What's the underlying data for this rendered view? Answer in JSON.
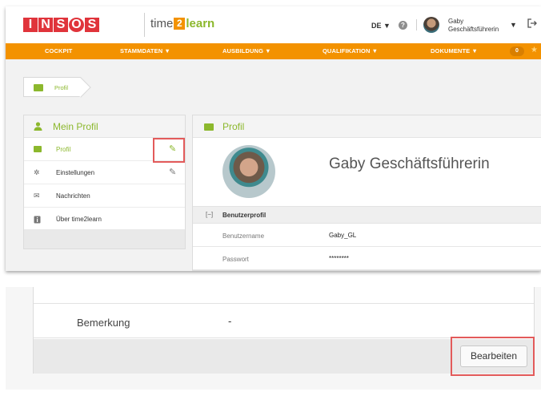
{
  "header": {
    "logo_letters": [
      "I",
      "N",
      "S",
      "O",
      "S"
    ],
    "brand": {
      "part1": "time",
      "part2": "2",
      "part3": "learn"
    },
    "language": "DE ▼",
    "help_icon": "help-icon",
    "user": {
      "first_name": "Gaby",
      "role": "Geschäftsführerin"
    },
    "user_caret": "▼",
    "logout_icon": "logout-icon"
  },
  "nav": {
    "items": [
      "COCKPIT",
      "STAMMDATEN ▼",
      "AUSBILDUNG ▼",
      "QUALIFIKATION ▼",
      "DOKUMENTE ▼"
    ],
    "badge": "0",
    "star_icon": "star-icon"
  },
  "breadcrumb": {
    "label": "Profil"
  },
  "sidebar": {
    "title": "Mein Profil",
    "items": [
      {
        "label": "Profil",
        "icon": "id-card-icon"
      },
      {
        "label": "Einstellungen",
        "icon": "gear-icon"
      },
      {
        "label": "Nachrichten",
        "icon": "envelope-icon"
      },
      {
        "label": "Über time2learn",
        "icon": "info-icon"
      }
    ]
  },
  "main": {
    "title": "Profil",
    "full_name": "Gaby Geschäftsführerin",
    "section": {
      "toggle": "[−]",
      "label": "Benutzerprofil"
    },
    "fields": [
      {
        "key": "Benutzername",
        "value": "Gaby_GL"
      },
      {
        "key": "Passwort",
        "value": "********"
      }
    ]
  },
  "bottom": {
    "field_key": "Bemerkung",
    "field_value": "-",
    "edit_button": "Bearbeiten"
  },
  "colors": {
    "orange": "#f39200",
    "green": "#8cb82d",
    "logo_red": "#e0343b",
    "highlight": "#e35b5b"
  }
}
